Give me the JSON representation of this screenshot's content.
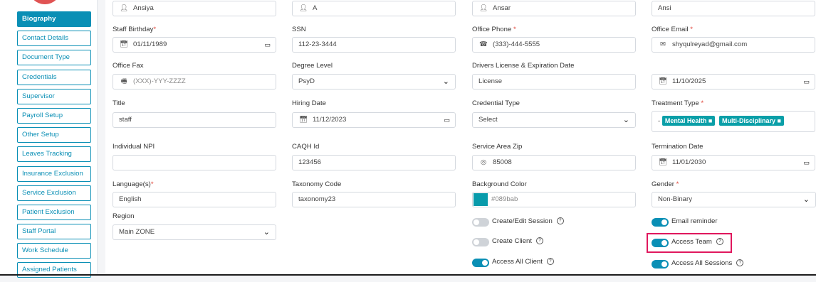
{
  "sidebar": {
    "items": [
      {
        "label": "Biography",
        "active": true
      },
      {
        "label": "Contact Details"
      },
      {
        "label": "Document Type"
      },
      {
        "label": "Credentials"
      },
      {
        "label": "Supervisor"
      },
      {
        "label": "Payroll Setup"
      },
      {
        "label": "Other Setup"
      },
      {
        "label": "Leaves Tracking"
      },
      {
        "label": "Insurance Exclusion"
      },
      {
        "label": "Service Exclusion"
      },
      {
        "label": "Patient Exclusion"
      },
      {
        "label": "Staff Portal"
      },
      {
        "label": "Work Schedule"
      },
      {
        "label": "Assigned Patients"
      }
    ]
  },
  "form": {
    "first_name": "Ansiya",
    "middle_name": "A",
    "last_name": "Ansar",
    "nickname": "Ansi",
    "staff_birthday": {
      "label": "Staff Birthday",
      "required": "*",
      "value": "01/11/1989"
    },
    "ssn": {
      "label": "SSN",
      "value": "112-23-3444"
    },
    "office_phone": {
      "label": "Office Phone",
      "required": "*",
      "value": "(333)-444-5555"
    },
    "office_email": {
      "label": "Office Email",
      "required": "*",
      "value": "shyqulreyad@gmail.com"
    },
    "office_fax": {
      "label": "Office Fax",
      "placeholder": "(XXX)-YYY-ZZZZ"
    },
    "degree_level": {
      "label": "Degree Level",
      "value": "PsyD"
    },
    "drivers_license": {
      "label": "Drivers License & Expiration Date",
      "value": "License",
      "date": "11/10/2025"
    },
    "title": {
      "label": "Title",
      "value": "staff"
    },
    "hiring_date": {
      "label": "Hiring Date",
      "value": "11/12/2023"
    },
    "credential_type": {
      "label": "Credential Type",
      "value": "Select"
    },
    "treatment_type": {
      "label": "Treatment Type",
      "required": "*",
      "prefix": "-",
      "tags": [
        "Mental Health",
        "Multi-Disciplinary"
      ]
    },
    "individual_npi": {
      "label": "Individual NPI",
      "value": ""
    },
    "caqh_id": {
      "label": "CAQH Id",
      "value": "123456"
    },
    "service_area_zip": {
      "label": "Service Area Zip",
      "value": "85008"
    },
    "termination_date": {
      "label": "Termination Date",
      "value": "11/01/2030"
    },
    "language": {
      "label": "Language(s)",
      "required": "*",
      "value": "English"
    },
    "taxonomy_code": {
      "label": "Taxonomy Code",
      "value": "taxonomy23"
    },
    "background_color": {
      "label": "Background Color",
      "value": "#089bab"
    },
    "gender": {
      "label": "Gender",
      "required": "*",
      "value": "Non-Binary"
    },
    "region": {
      "label": "Region",
      "value": "Main ZONE"
    }
  },
  "toggles": {
    "create_edit_session": {
      "label": "Create/Edit Session",
      "on": false
    },
    "create_client": {
      "label": "Create Client",
      "on": false
    },
    "access_all_client": {
      "label": "Access All Client",
      "on": true
    },
    "email_reminder": {
      "label": "Email reminder",
      "on": true
    },
    "access_team": {
      "label": "Access Team",
      "on": true
    },
    "access_all_sessions": {
      "label": "Access All Sessions",
      "on": true
    }
  },
  "icons": {
    "person": "person-icon",
    "calendar": "calendar-icon",
    "phone": "phone-icon",
    "mail": "mail-icon",
    "fax": "fax-icon",
    "location": "location-pin-icon",
    "help": "help-circle-icon"
  },
  "colors": {
    "accent": "#0a8fb5",
    "highlight": "#e0175d",
    "tag": "#0a9fa8",
    "swatch": "#089bab"
  },
  "glyphs": {
    "help": "?",
    "tag_remove": "■",
    "calendar_picker": "▭",
    "chevron": "⌄"
  }
}
